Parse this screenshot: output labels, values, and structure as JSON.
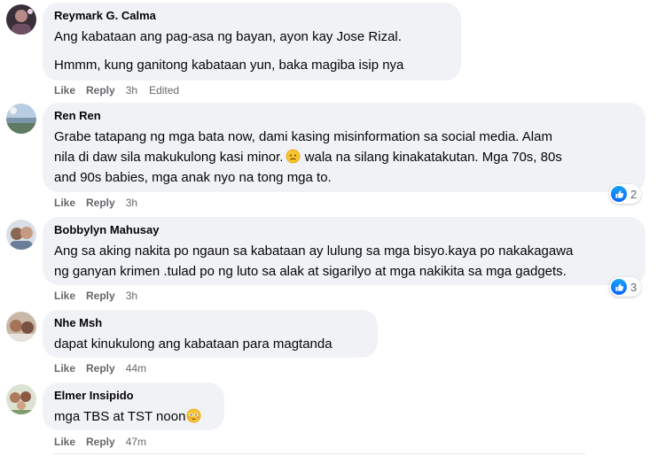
{
  "comments": [
    {
      "author": "Reymark G. Calma",
      "paragraphs": [
        "Ang kabataan ang pag-asa ng bayan, ayon kay Jose Rizal.",
        "Hmmm, kung ganitong kabataan yun, baka magiba isip nya"
      ],
      "like": "Like",
      "reply": "Reply",
      "time": "3h",
      "edited": "Edited"
    },
    {
      "author": "Ren Ren",
      "lines": [
        "Grabe tatapang ng mga bata now, dami kasing misinformation sa social media. Alam",
        "nila di daw sila makukulong kasi minor.",
        "wala na silang kinakatakutan. Mga 70s, 80s",
        "and 90s babies, mga anak nyo na tong mga to."
      ],
      "emoji": "worried-face",
      "like": "Like",
      "reply": "Reply",
      "time": "3h",
      "reaction_icon": "like-icon",
      "reaction_count": "2"
    },
    {
      "author": "Bobbylyn Mahusay",
      "lines": [
        "Ang sa aking nakita po ngaun sa kabataan ay lulung sa mga bisyo.kaya po nakakagawa",
        "ng ganyan krimen .tulad po ng luto sa alak at sigarilyo at mga nakikita sa mga gadgets."
      ],
      "like": "Like",
      "reply": "Reply",
      "time": "3h",
      "reaction_icon": "like-icon",
      "reaction_count": "3"
    },
    {
      "author": "Nhe Msh",
      "lines": [
        "dapat kinukulong ang kabataan para magtanda"
      ],
      "like": "Like",
      "reply": "Reply",
      "time": "44m"
    },
    {
      "author": "Elmer Insipido",
      "lines": [
        "mga TBS at TST noon"
      ],
      "emoji": "flushed-face",
      "like": "Like",
      "reply": "Reply",
      "time": "47m"
    }
  ],
  "colors": {
    "bubble": "#f0f2f5",
    "secondary_text": "#65676b",
    "like_blue": "#0866ff"
  }
}
